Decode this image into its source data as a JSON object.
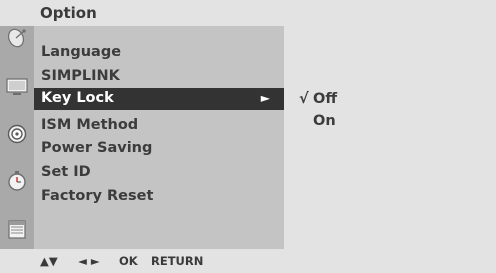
{
  "title": "Option",
  "menu": {
    "items": [
      {
        "label": "Language"
      },
      {
        "label": "SIMPLINK"
      },
      {
        "label": "Key Lock",
        "selected": true,
        "arrow": "►"
      },
      {
        "label": "ISM Method"
      },
      {
        "label": "Power Saving"
      },
      {
        "label": "Set ID"
      },
      {
        "label": "Factory Reset"
      }
    ]
  },
  "submenu": {
    "options": [
      {
        "check": "√",
        "label": "Off",
        "checked": true
      },
      {
        "check": "",
        "label": "On",
        "checked": false
      }
    ]
  },
  "footer": {
    "updown": "▲▼",
    "leftright": "◄ ►",
    "ok": "OK",
    "return": "RETURN"
  },
  "icons": [
    "satellite-dish-icon",
    "monitor-icon",
    "speaker-icon",
    "clock-icon",
    "calendar-icon"
  ],
  "colors": {
    "background": "#e3e3e3",
    "menu_panel": "#c4c4c4",
    "icon_column": "#a9a9a9",
    "selected_bg": "#333333",
    "text": "#3c3c3c"
  }
}
